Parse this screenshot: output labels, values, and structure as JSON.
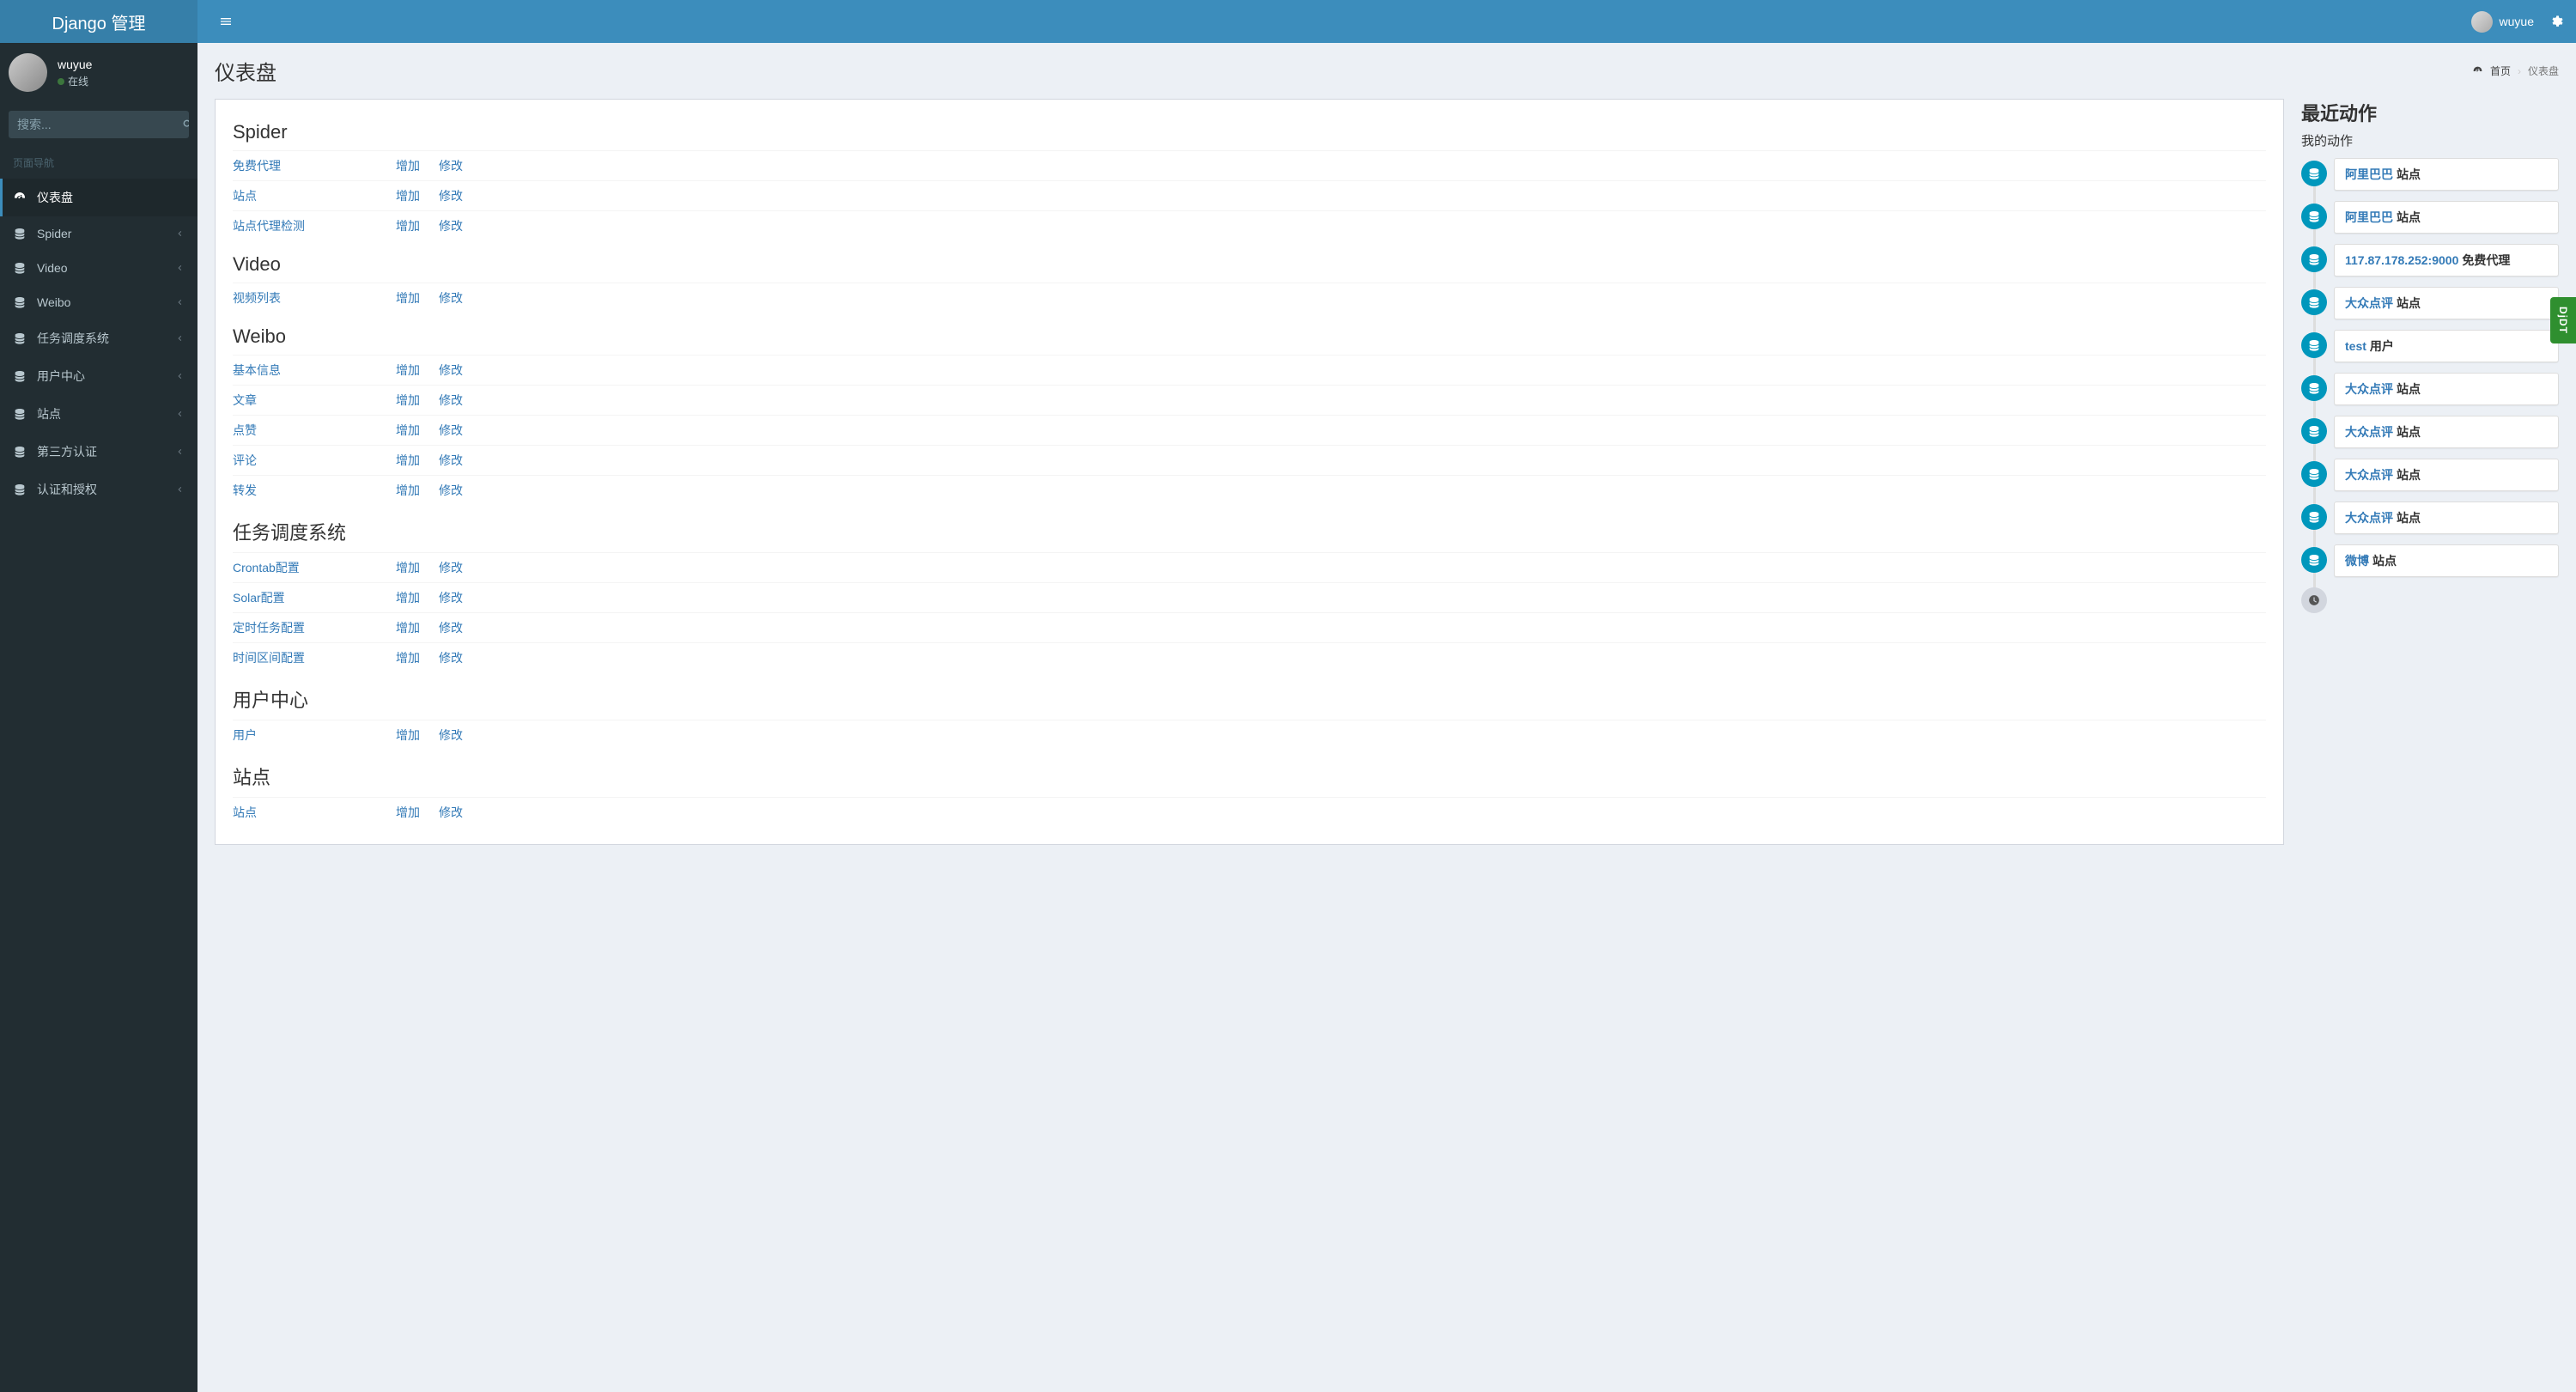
{
  "brand": "Django 管理",
  "topbar": {
    "username": "wuyue"
  },
  "sidebar": {
    "user": {
      "name": "wuyue",
      "status": "在线"
    },
    "search_placeholder": "搜索...",
    "header": "页面导航",
    "items": [
      {
        "icon": "dashboard",
        "label": "仪表盘",
        "active": true,
        "expandable": false
      },
      {
        "icon": "db",
        "label": "Spider",
        "active": false,
        "expandable": true
      },
      {
        "icon": "db",
        "label": "Video",
        "active": false,
        "expandable": true
      },
      {
        "icon": "db",
        "label": "Weibo",
        "active": false,
        "expandable": true
      },
      {
        "icon": "db",
        "label": "任务调度系统",
        "active": false,
        "expandable": true
      },
      {
        "icon": "db",
        "label": "用户中心",
        "active": false,
        "expandable": true
      },
      {
        "icon": "db",
        "label": "站点",
        "active": false,
        "expandable": true
      },
      {
        "icon": "db",
        "label": "第三方认证",
        "active": false,
        "expandable": true
      },
      {
        "icon": "db",
        "label": "认证和授权",
        "active": false,
        "expandable": true
      }
    ]
  },
  "page": {
    "title": "仪表盘",
    "breadcrumb": {
      "home": "首页",
      "current": "仪表盘"
    }
  },
  "actions": {
    "add": "增加",
    "change": "修改"
  },
  "apps": [
    {
      "name": "Spider",
      "models": [
        "免费代理",
        "站点",
        "站点代理检测"
      ]
    },
    {
      "name": "Video",
      "models": [
        "视频列表"
      ]
    },
    {
      "name": "Weibo",
      "models": [
        "基本信息",
        "文章",
        "点赞",
        "评论",
        "转发"
      ]
    },
    {
      "name": "任务调度系统",
      "models": [
        "Crontab配置",
        "Solar配置",
        "定时任务配置",
        "时间区间配置"
      ]
    },
    {
      "name": "用户中心",
      "models": [
        "用户"
      ]
    },
    {
      "name": "站点",
      "models": [
        "站点"
      ]
    }
  ],
  "recent": {
    "title": "最近动作",
    "subtitle": "我的动作",
    "items": [
      {
        "link": "阿里巴巴",
        "type": "站点"
      },
      {
        "link": "阿里巴巴",
        "type": "站点"
      },
      {
        "link": "117.87.178.252:9000",
        "type": "免费代理"
      },
      {
        "link": "大众点评",
        "type": "站点"
      },
      {
        "link": "test",
        "type": "用户"
      },
      {
        "link": "大众点评",
        "type": "站点"
      },
      {
        "link": "大众点评",
        "type": "站点"
      },
      {
        "link": "大众点评",
        "type": "站点"
      },
      {
        "link": "大众点评",
        "type": "站点"
      },
      {
        "link": "微博",
        "type": "站点"
      }
    ]
  },
  "djdt_label": "DjDT"
}
